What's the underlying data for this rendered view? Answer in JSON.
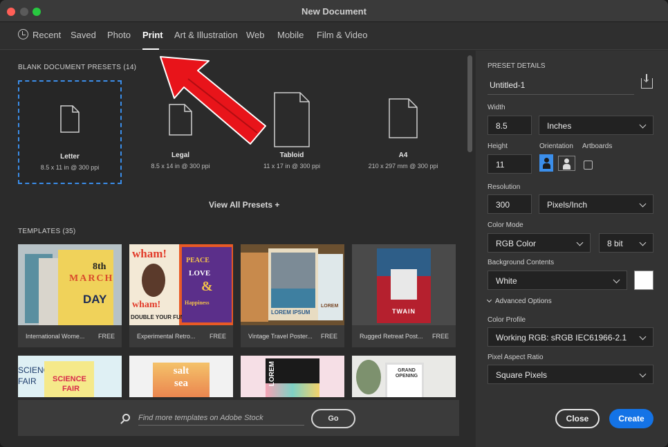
{
  "window": {
    "title": "New Document"
  },
  "tabs": [
    {
      "label": "Recent"
    },
    {
      "label": "Saved"
    },
    {
      "label": "Photo"
    },
    {
      "label": "Print",
      "active": true
    },
    {
      "label": "Art & Illustration"
    },
    {
      "label": "Web"
    },
    {
      "label": "Mobile"
    },
    {
      "label": "Film & Video"
    }
  ],
  "blank_presets": {
    "heading": "BLANK DOCUMENT PRESETS",
    "count": "(14)",
    "items": [
      {
        "name": "Letter",
        "size": "8.5 x 11 in @ 300 ppi",
        "selected": true
      },
      {
        "name": "Legal",
        "size": "8.5 x 14 in @ 300 ppi"
      },
      {
        "name": "Tabloid",
        "size": "11 x 17 in @ 300 ppi"
      },
      {
        "name": "A4",
        "size": "210 x 297 mm @ 300 ppi"
      }
    ],
    "view_all": "View All Presets +"
  },
  "templates": {
    "heading": "TEMPLATES",
    "count": "(35)",
    "items": [
      {
        "name": "International Wome...",
        "tag": "FREE",
        "thumb_text": [
          "8th",
          "MARCH",
          "DAY"
        ]
      },
      {
        "name": "Experimental Retro...",
        "tag": "FREE",
        "thumb_text": [
          "wham!",
          "PEACE",
          "LOVE",
          "&",
          "Happiness",
          "DOUBLE YOUR FUN"
        ]
      },
      {
        "name": "Vintage Travel Poster...",
        "tag": "FREE",
        "thumb_text": [
          "LOREM IPSUM",
          "LOREM"
        ]
      },
      {
        "name": "Rugged Retreat Post...",
        "tag": "FREE",
        "thumb_text": [
          "TWAIN"
        ]
      }
    ],
    "row2_text": [
      [
        "SCIENCE",
        "SCIENCE",
        "FAIR",
        "FAIR"
      ],
      [
        "salt",
        "sea"
      ],
      [
        "LOREM"
      ],
      [
        "GRAND",
        "OPENING"
      ]
    ]
  },
  "search": {
    "placeholder": "Find more templates on Adobe Stock",
    "go_label": "Go"
  },
  "details": {
    "heading": "PRESET DETAILS",
    "name": "Untitled-1",
    "width_label": "Width",
    "width": "8.5",
    "width_unit": "Inches",
    "height_label": "Height",
    "height": "11",
    "orientation_label": "Orientation",
    "artboards_label": "Artboards",
    "resolution_label": "Resolution",
    "resolution": "300",
    "resolution_unit": "Pixels/Inch",
    "color_mode_label": "Color Mode",
    "color_mode": "RGB Color",
    "bit_depth": "8 bit",
    "bg_label": "Background Contents",
    "bg": "White",
    "advanced": "Advanced Options",
    "profile_label": "Color Profile",
    "profile": "Working RGB: sRGB IEC61966-2.1",
    "pixel_ratio_label": "Pixel Aspect Ratio",
    "pixel_ratio": "Square Pixels",
    "close_label": "Close",
    "create_label": "Create"
  },
  "colors": {
    "accent": "#1473e6",
    "selection": "#3b8eea",
    "arrow": "#e8141a"
  }
}
